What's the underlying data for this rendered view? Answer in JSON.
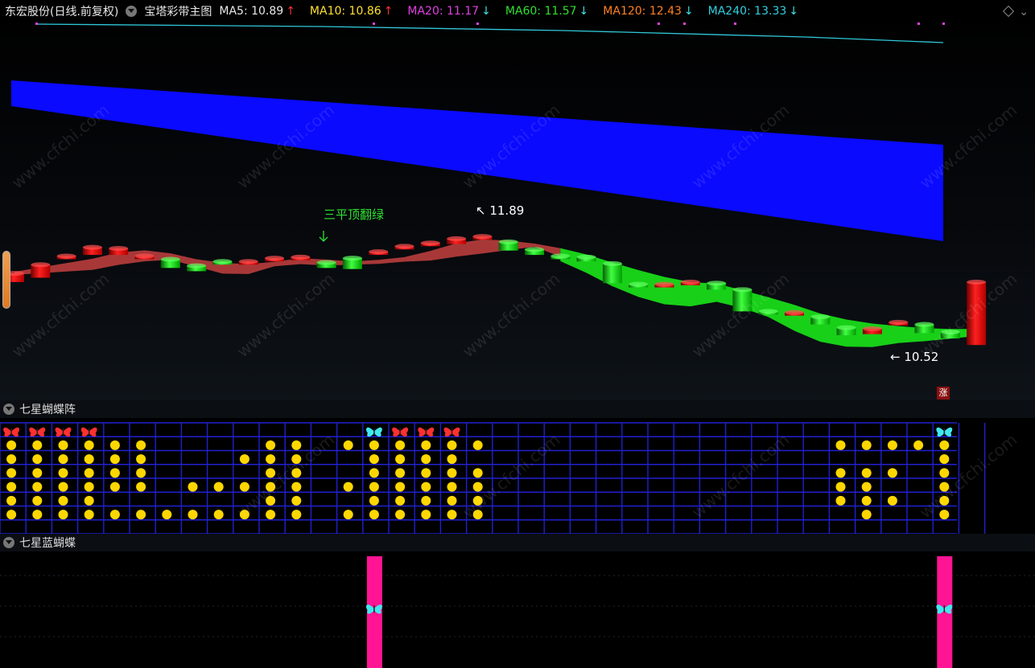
{
  "header": {
    "stock": "东宏股份(日线.前复权)",
    "indicator": "宝塔彩带主图",
    "ma": [
      {
        "label": "MA5: 10.89",
        "arrow": "↑",
        "color": "#e8e8e8",
        "arrow_color": "#ff3030"
      },
      {
        "label": "MA10: 10.86",
        "arrow": "↑",
        "color": "#ffe030",
        "arrow_color": "#ff3030"
      },
      {
        "label": "MA20: 11.17",
        "arrow": "↓",
        "color": "#e040e0",
        "arrow_color": "#40e0e0"
      },
      {
        "label": "MA60: 11.57",
        "arrow": "↓",
        "color": "#30e030",
        "arrow_color": "#40e0e0"
      },
      {
        "label": "MA120: 12.43",
        "arrow": "↓",
        "color": "#ff8020",
        "arrow_color": "#40e0e0"
      },
      {
        "label": "MA240: 13.33",
        "arrow": "↓",
        "color": "#30d0e0",
        "arrow_color": "#40e0e0"
      }
    ]
  },
  "annotations": {
    "signal": "三平顶翻绿",
    "high_label": "11.89",
    "low_label": "10.52",
    "rise_badge": "涨"
  },
  "panel2": {
    "title": "七星蝴蝶阵"
  },
  "panel3": {
    "title": "七星蓝蝴蝶"
  },
  "watermark": "www.cfchi.com",
  "colors": {
    "up": "#e01010",
    "down": "#10d010",
    "band_blue": "#0a0aff",
    "grid": "#2020d0",
    "dot": "#ffd700",
    "pink_bar": "#ff1493"
  },
  "chart_data": {
    "type": "candlestick",
    "high": 11.89,
    "low": 10.52,
    "candles": [
      {
        "o": 11.18,
        "c": 11.26
      },
      {
        "o": 11.22,
        "c": 11.34
      },
      {
        "o": 11.4,
        "c": 11.42
      },
      {
        "o": 11.43,
        "c": 11.5
      },
      {
        "o": 11.43,
        "c": 11.49
      },
      {
        "o": 11.41,
        "c": 11.42
      },
      {
        "o": 11.39,
        "c": 11.31
      },
      {
        "o": 11.33,
        "c": 11.28
      },
      {
        "o": 11.37,
        "c": 11.36
      },
      {
        "o": 11.34,
        "c": 11.37
      },
      {
        "o": 11.38,
        "c": 11.4
      },
      {
        "o": 11.39,
        "c": 11.41
      },
      {
        "o": 11.36,
        "c": 11.31
      },
      {
        "o": 11.4,
        "c": 11.3
      },
      {
        "o": 11.44,
        "c": 11.46
      },
      {
        "o": 11.5,
        "c": 11.51
      },
      {
        "o": 11.52,
        "c": 11.54
      },
      {
        "o": 11.53,
        "c": 11.58
      },
      {
        "o": 11.58,
        "c": 11.6
      },
      {
        "o": 11.55,
        "c": 11.47
      },
      {
        "o": 11.48,
        "c": 11.43
      },
      {
        "o": 11.42,
        "c": 11.41
      },
      {
        "o": 11.41,
        "c": 11.37
      },
      {
        "o": 11.35,
        "c": 11.17
      },
      {
        "o": 11.16,
        "c": 11.15
      },
      {
        "o": 11.16,
        "c": 11.16
      },
      {
        "o": 11.17,
        "c": 11.18
      },
      {
        "o": 11.17,
        "c": 11.11
      },
      {
        "o": 11.11,
        "c": 10.91
      },
      {
        "o": 10.91,
        "c": 10.9
      },
      {
        "o": 10.89,
        "c": 10.9
      },
      {
        "o": 10.86,
        "c": 10.79
      },
      {
        "o": 10.76,
        "c": 10.69
      },
      {
        "o": 10.7,
        "c": 10.75
      },
      {
        "o": 10.8,
        "c": 10.81
      },
      {
        "o": 10.79,
        "c": 10.71
      },
      {
        "o": 10.72,
        "c": 10.66
      },
      {
        "o": 10.6,
        "c": 11.18
      }
    ],
    "columns": 38,
    "dot_rows": 7,
    "butterfly_columns_red": [
      0,
      1,
      2,
      3,
      15,
      16,
      17
    ],
    "butterfly_columns_blue": [
      14,
      36
    ]
  }
}
